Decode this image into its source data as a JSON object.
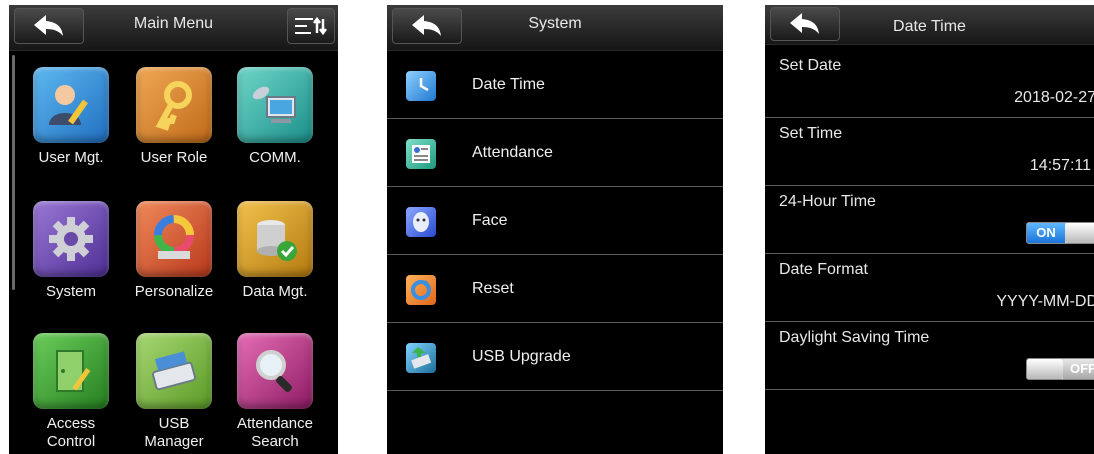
{
  "main_menu": {
    "title": "Main Menu",
    "items": [
      {
        "label": "User Mgt.",
        "icon": "user-edit-icon",
        "color": "#2f8fd6"
      },
      {
        "label": "User Role",
        "icon": "key-icon",
        "color": "#e08a2b"
      },
      {
        "label": "COMM.",
        "icon": "network-computer-icon",
        "color": "#22a9a3"
      },
      {
        "label": "System",
        "icon": "gear-icon",
        "color": "#7350b4"
      },
      {
        "label": "Personalize",
        "icon": "color-wheel-icon",
        "color": "#d4562d"
      },
      {
        "label": "Data Mgt.",
        "icon": "database-check-icon",
        "color": "#d9a21c"
      },
      {
        "label": "Access\nControl",
        "icon": "door-pen-icon",
        "color": "#3aa432"
      },
      {
        "label": "USB\nManager",
        "icon": "usb-drive-icon",
        "color": "#7fb53b"
      },
      {
        "label": "Attendance\nSearch",
        "icon": "magnifier-icon",
        "color": "#c22f8a"
      }
    ]
  },
  "system": {
    "title": "System",
    "items": [
      {
        "label": "Date Time",
        "icon": "clock-icon"
      },
      {
        "label": "Attendance",
        "icon": "attendance-icon"
      },
      {
        "label": "Face",
        "icon": "face-icon"
      },
      {
        "label": "Reset",
        "icon": "reset-icon"
      },
      {
        "label": "USB Upgrade",
        "icon": "usb-upgrade-icon"
      }
    ]
  },
  "date_time": {
    "title": "Date Time",
    "set_date_label": "Set Date",
    "set_date_value": "2018-02-27",
    "set_time_label": "Set Time",
    "set_time_value": "14:57:11",
    "hour24_label": "24-Hour Time",
    "hour24_state": "ON",
    "date_format_label": "Date Format",
    "date_format_value": "YYYY-MM-DD",
    "dst_label": "Daylight Saving Time",
    "dst_state": "OFF"
  }
}
